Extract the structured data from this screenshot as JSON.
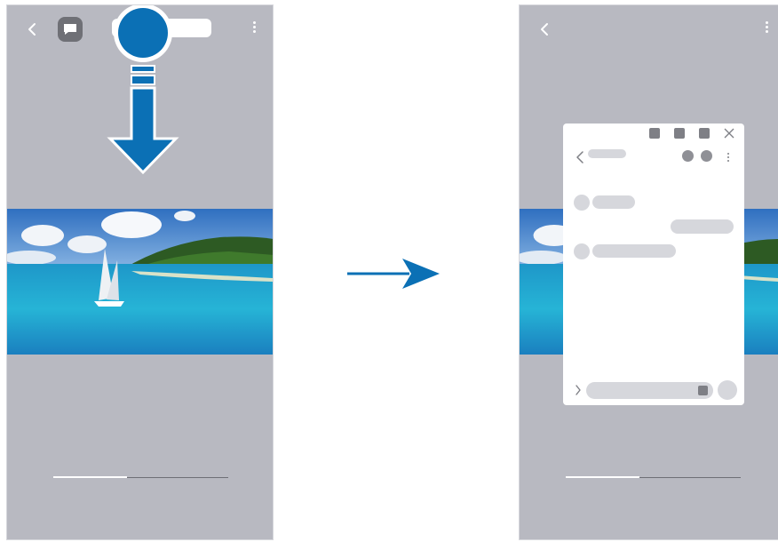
{
  "colors": {
    "screen_bg": "#b8b9c1",
    "accent": "#0b70b5",
    "placeholder": "#d6d7dc",
    "icon_gray": "#7e7f85"
  },
  "left_screen": {
    "icons": [
      "back-icon",
      "chat-icon",
      "more-icon"
    ],
    "gesture": "drag-down",
    "video_progress": 0.42
  },
  "transition": {
    "icon": "right-arrow-icon"
  },
  "right_screen": {
    "icons": [
      "back-icon",
      "more-icon"
    ],
    "popup": {
      "window_controls": [
        "minimize-icon",
        "resize-icon",
        "fullscreen-icon",
        "close-icon"
      ],
      "header_icons": [
        "back-icon",
        "more-icon"
      ],
      "footer_icons": [
        "expand-icon",
        "send-button"
      ]
    },
    "video_progress": 0.42
  }
}
